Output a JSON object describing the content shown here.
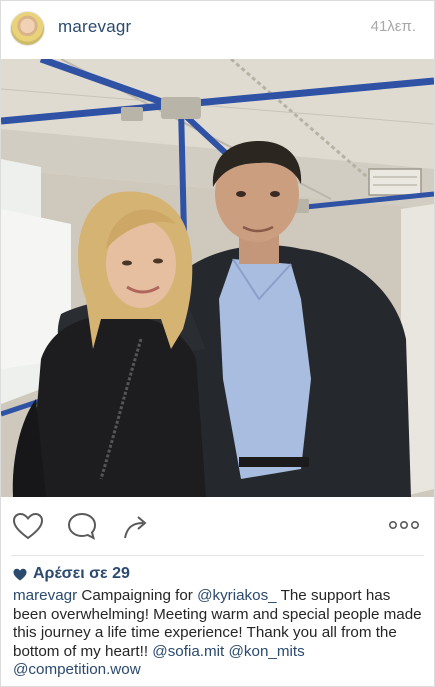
{
  "post": {
    "username": "marevagr",
    "timestamp": "41λεπ.",
    "likes_text": "Αρέσει σε 29",
    "caption": {
      "username": "marevagr",
      "seg1": "Campaigning for ",
      "mention1": "@kyriakos_",
      "seg2": "  The support has been overwhelming! Meeting warm and special people made this journey a life time experience! Thank you all from the bottom of my heart!! ",
      "mention2": "@sofia.mit",
      "mention3": "@kon_mits",
      "mention4": "@competition.wow"
    }
  },
  "icons": {
    "avatar": "profile-avatar",
    "like": "heart-outline-icon",
    "comment": "speech-bubble-icon",
    "share": "share-arrow-icon",
    "more": "ellipsis-icon",
    "likes": "heart-filled-icon"
  },
  "colors": {
    "link": "#2b4a6e",
    "text": "#262626",
    "muted": "#a8a8a8",
    "icon": "#5a5a5a"
  }
}
